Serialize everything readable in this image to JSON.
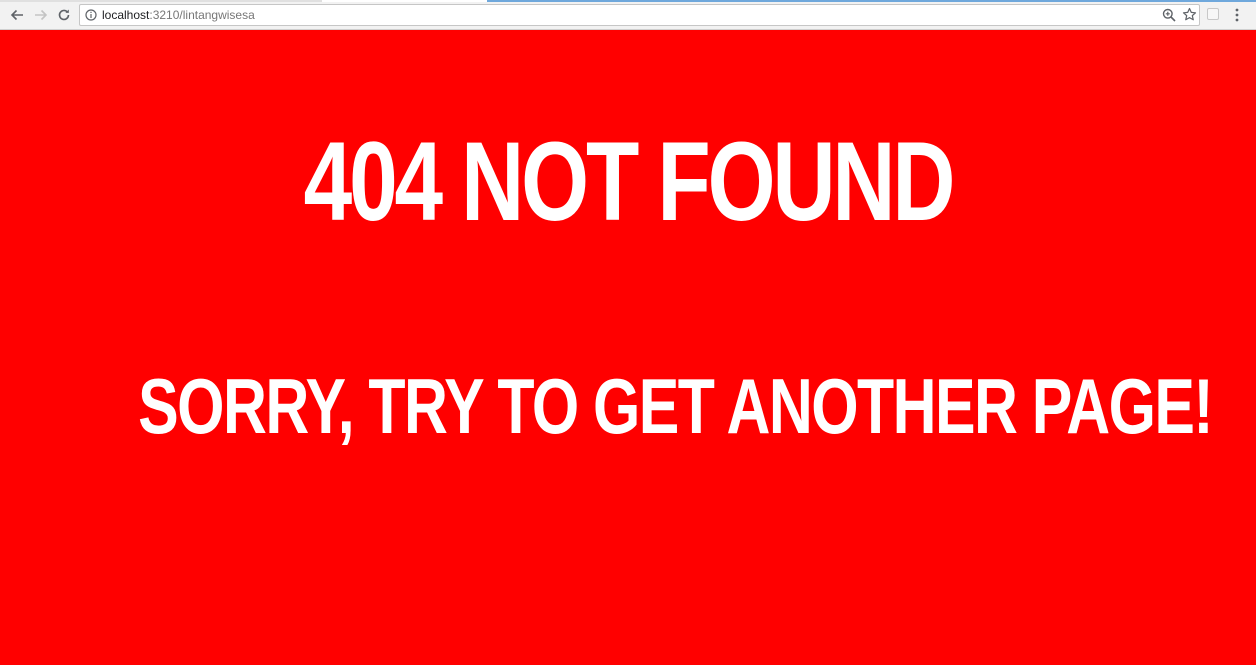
{
  "browser": {
    "url_host": "localhost",
    "url_path": ":3210/lintangwisesa",
    "icons": {
      "back": "arrow-left-icon",
      "forward": "arrow-right-icon",
      "reload": "reload-icon",
      "info": "info-icon",
      "zoom": "zoom-icon",
      "bookmark": "star-icon",
      "extension": "extension-icon",
      "menu": "kebab-menu-icon"
    }
  },
  "page": {
    "background_color": "#ff0000",
    "text_color": "#ffffff",
    "heading": "404 NOT FOUND",
    "message": "SORRY, TRY TO GET ANOTHER PAGE!"
  }
}
